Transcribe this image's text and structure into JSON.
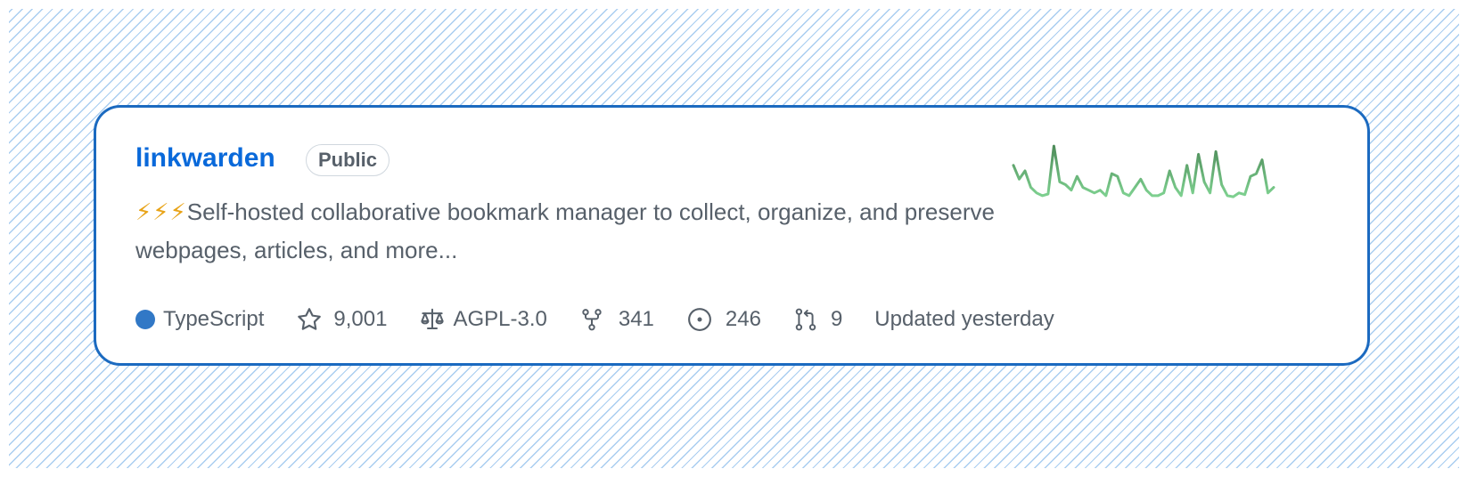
{
  "repo": {
    "name": "linkwarden",
    "visibility": "Public",
    "description_prefix": "⚡⚡⚡",
    "description": "Self-hosted collaborative bookmark manager to collect, organize, and preserve webpages, articles, and more..."
  },
  "meta": {
    "language": "TypeScript",
    "language_color": "#3178c6",
    "stars": "9,001",
    "license": "AGPL-3.0",
    "forks": "341",
    "issues": "246",
    "pull_requests": "9",
    "updated": "Updated yesterday"
  },
  "icons": {
    "stars": "star-icon",
    "license": "law-scale-icon",
    "forks": "repo-forked-icon",
    "issues": "issue-opened-icon",
    "pull_requests": "git-pull-request-icon"
  },
  "colors": {
    "accent_link": "#0969da",
    "card_border": "#1b6ac0",
    "background_hatch": "#a9cdf0",
    "sparkline_start": "#4e8c5a",
    "sparkline_end": "#7ed190"
  },
  "activity_sparkline": [
    0.6,
    0.35,
    0.5,
    0.2,
    0.1,
    0.05,
    0.08,
    0.95,
    0.3,
    0.25,
    0.15,
    0.4,
    0.2,
    0.15,
    0.1,
    0.15,
    0.05,
    0.45,
    0.4,
    0.1,
    0.05,
    0.2,
    0.35,
    0.15,
    0.05,
    0.05,
    0.1,
    0.5,
    0.2,
    0.05,
    0.6,
    0.1,
    0.8,
    0.3,
    0.1,
    0.85,
    0.25,
    0.05,
    0.03,
    0.1,
    0.07,
    0.4,
    0.45,
    0.7,
    0.1,
    0.2
  ]
}
